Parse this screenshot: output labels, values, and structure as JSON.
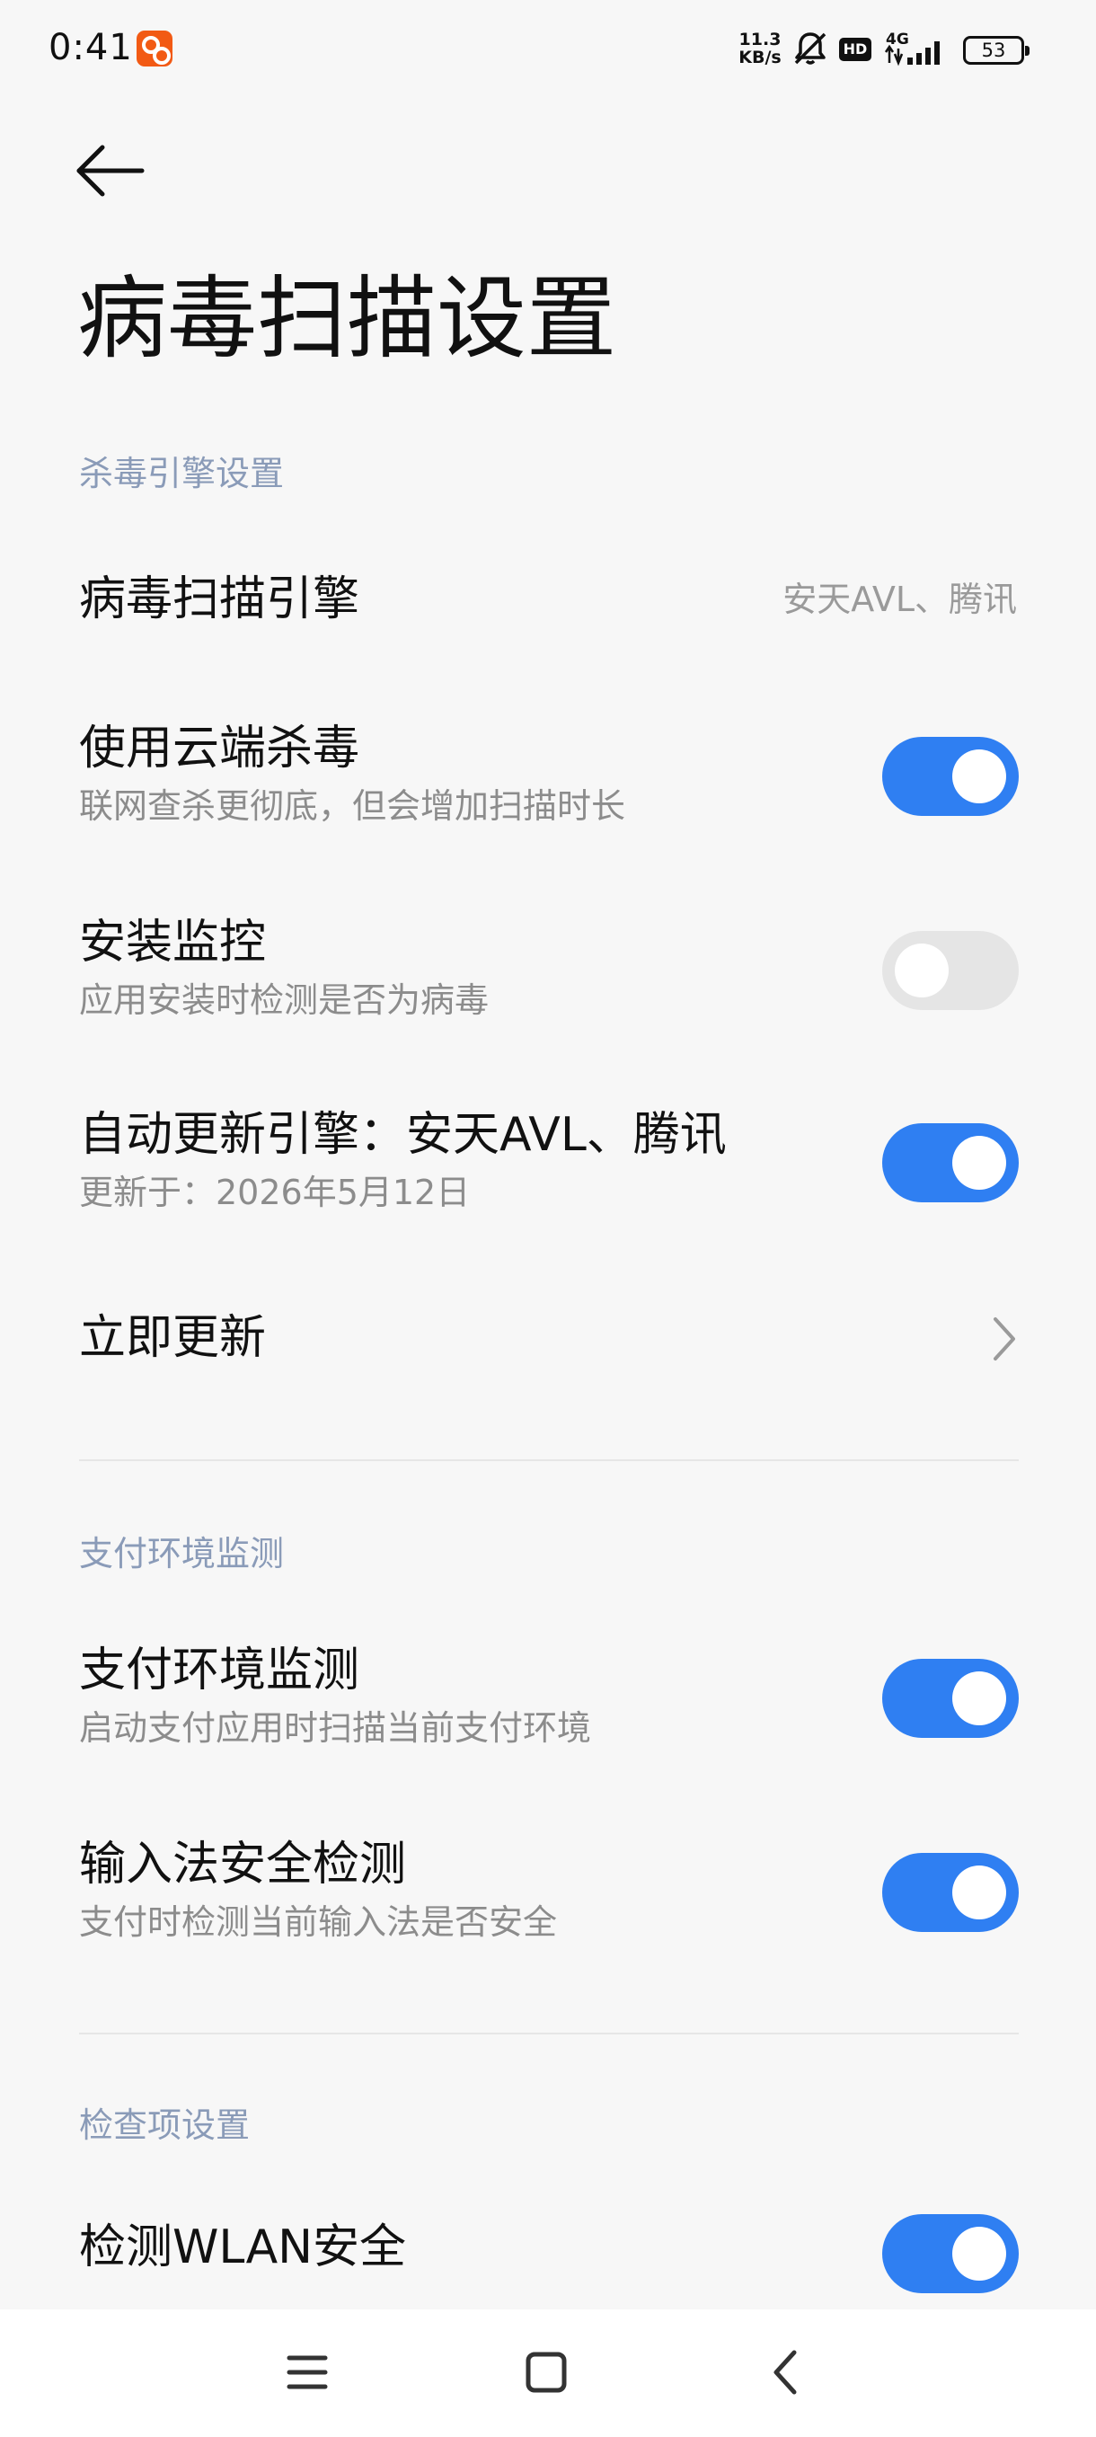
{
  "status_bar": {
    "time": "0:41",
    "net_speed_value": "11.3",
    "net_speed_unit": "KB/s",
    "hd": "HD",
    "net_type": "4G",
    "battery": "53",
    "icons": [
      "app-badge-icon",
      "mute-bell-icon",
      "hd-icon",
      "signal-icon",
      "battery-icon"
    ]
  },
  "header": {
    "back_icon": "arrow-left-icon",
    "title": "病毒扫描设置"
  },
  "sections": {
    "engine": {
      "header": "杀毒引擎设置",
      "scan_engine": {
        "title": "病毒扫描引擎",
        "value": "安天AVL、腾讯"
      },
      "cloud_kill": {
        "title": "使用云端杀毒",
        "subtitle": "联网查杀更彻底，但会增加扫描时长",
        "enabled": true
      },
      "install_monitor": {
        "title": "安装监控",
        "subtitle": "应用安装时检测是否为病毒",
        "enabled": false
      },
      "auto_update": {
        "title": "自动更新引擎：安天AVL、腾讯",
        "subtitle": "更新于：2026年5月12日",
        "enabled": true
      },
      "update_now": {
        "title": "立即更新",
        "icon": "chevron-right-icon"
      }
    },
    "payment": {
      "header": "支付环境监测",
      "payment_monitor": {
        "title": "支付环境监测",
        "subtitle": "启动支付应用时扫描当前支付环境",
        "enabled": true
      },
      "ime_check": {
        "title": "输入法安全检测",
        "subtitle": "支付时检测当前输入法是否安全",
        "enabled": true
      }
    },
    "checks": {
      "header": "检查项设置",
      "wlan": {
        "title": "检测WLAN安全",
        "enabled": true
      }
    }
  },
  "nav_bar": {
    "icons": [
      "menu-icon",
      "home-square-icon",
      "back-chevron-icon"
    ]
  },
  "colors": {
    "accent": "#2f7ff2",
    "toggle_off": "#e5e5e5",
    "section_header": "#8a9bb8",
    "background": "#f7f7f7"
  }
}
